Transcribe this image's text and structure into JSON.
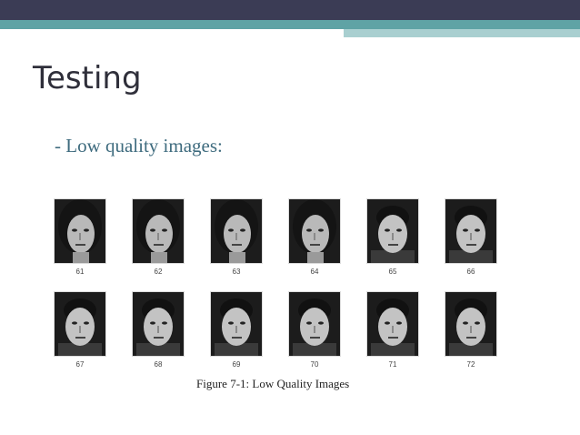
{
  "slide": {
    "title": "Testing",
    "bullet": "- Low quality images:",
    "figure": {
      "caption": "Figure 7-1: Low Quality Images",
      "rows": [
        [
          {
            "label": "61",
            "subject": "woman"
          },
          {
            "label": "62",
            "subject": "woman"
          },
          {
            "label": "63",
            "subject": "woman"
          },
          {
            "label": "64",
            "subject": "woman"
          },
          {
            "label": "65",
            "subject": "man"
          },
          {
            "label": "66",
            "subject": "man"
          }
        ],
        [
          {
            "label": "67",
            "subject": "man"
          },
          {
            "label": "68",
            "subject": "man"
          },
          {
            "label": "69",
            "subject": "man"
          },
          {
            "label": "70",
            "subject": "man"
          },
          {
            "label": "71",
            "subject": "man"
          },
          {
            "label": "72",
            "subject": "man"
          }
        ]
      ]
    }
  },
  "colors": {
    "top_bar": "#3b3c55",
    "accent_bar": "#5fa3a5",
    "accent_bar_light": "#a9cfd0",
    "title": "#2f2f3a",
    "bullet": "#3e6b7e"
  }
}
